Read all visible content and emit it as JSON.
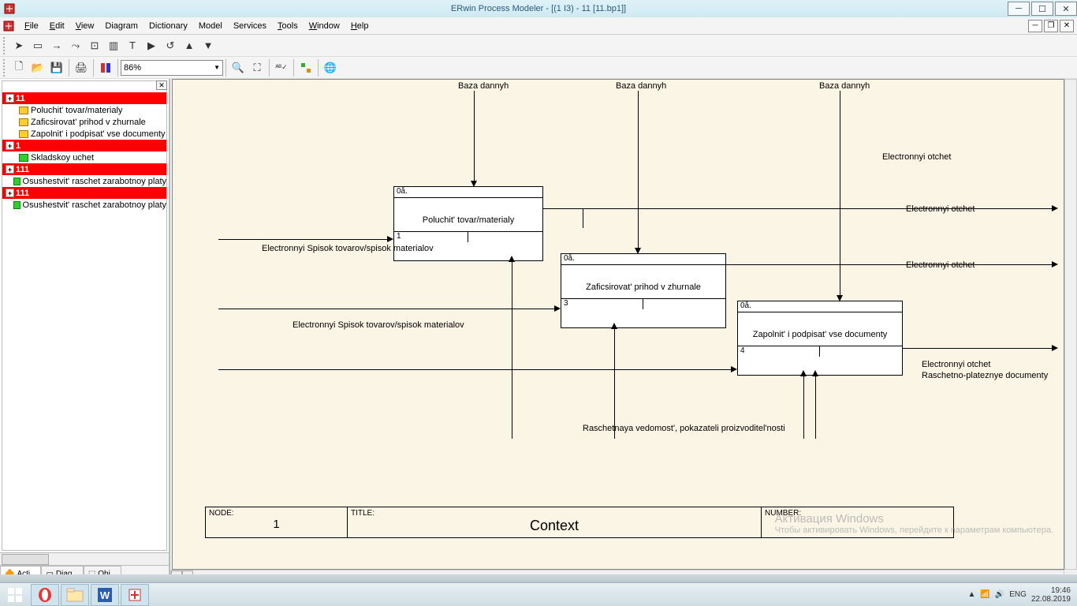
{
  "titlebar": {
    "title": "ERwin Process Modeler - [(1 І3)  - 11  [11.bp1]]"
  },
  "menu": {
    "file": "File",
    "edit": "Edit",
    "view": "View",
    "diagram": "Diagram",
    "dictionary": "Dictionary",
    "model": "Model",
    "services": "Services",
    "tools": "Tools",
    "window": "Window",
    "help": "Help"
  },
  "zoom": {
    "value": "86%"
  },
  "tree": {
    "n1": "11",
    "n1a": "Poluchit' tovar/materialy",
    "n1b": "Zaficsirovat' prihod v zhurnale",
    "n1c": "Zapolnit' i podpisat' vse documenty",
    "n2": "1",
    "n2a": "Skladskoy uchet",
    "n3": "111",
    "n3a": "Osushestvit' raschet  zarabotnoy platy",
    "n4": "111",
    "n4a": "Osushestvit' raschet  zarabotnoy platy"
  },
  "extabs": {
    "t1": "Acti...",
    "t2": "Diag...",
    "t3": "Obj..."
  },
  "diagram": {
    "box1": {
      "top": "0å.",
      "label": "Poluchit' tovar/materialy",
      "num": "1"
    },
    "box2": {
      "top": "0å.",
      "label": "Zaficsirovat' prihod v zhurnale",
      "num": "3"
    },
    "box3": {
      "top": "0å.",
      "label": "Zapolnit' i podpisat' vse documenty",
      "num": "4"
    },
    "labels": {
      "baza1": "Baza dannyh",
      "baza2": "Baza dannyh",
      "baza3": "Baza dannyh",
      "e_otchet": "Electronnyi otchet",
      "spisok1": "Electronnyi Spisok tovarov/spisok materialov",
      "spisok2": "Electronnyi Spisok tovarov/spisok materialov",
      "rasved": "Raschetnaya vedomost', pokazateli proizvoditel'nosti",
      "rasplat": "Raschetno-plateznye documenty"
    }
  },
  "titleblock": {
    "node": "NODE:",
    "node_val": "1",
    "title_lbl": "TITLE:",
    "title_val": "Context",
    "number": "NUMBER:"
  },
  "watermark": {
    "line1": "Активация Windows",
    "line2": "Чтобы активировать Windows, перейдите к параметрам компьютера."
  },
  "tray": {
    "lang": "ENG",
    "time": "19:46",
    "date": "22.08.2019"
  }
}
